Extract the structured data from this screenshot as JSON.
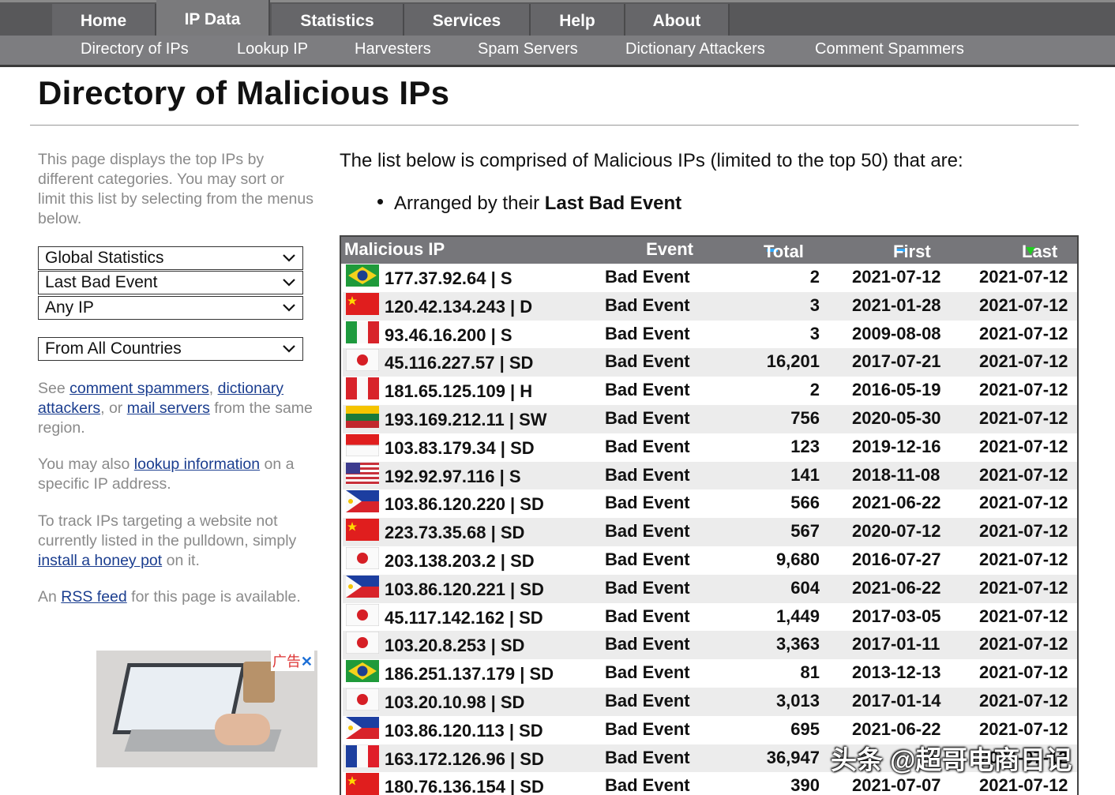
{
  "nav": {
    "tabs": [
      {
        "label": "Home"
      },
      {
        "label": "IP Data"
      },
      {
        "label": "Statistics"
      },
      {
        "label": "Services"
      },
      {
        "label": "Help"
      },
      {
        "label": "About"
      }
    ],
    "subtabs": [
      {
        "label": "Directory of IPs"
      },
      {
        "label": "Lookup IP"
      },
      {
        "label": "Harvesters"
      },
      {
        "label": "Spam Servers"
      },
      {
        "label": "Dictionary Attackers"
      },
      {
        "label": "Comment Spammers"
      }
    ]
  },
  "page": {
    "title": "Directory of Malicious IPs"
  },
  "sidebar": {
    "intro": "This page displays the top IPs by different categories. You may sort or limit this list by selecting from the menus below.",
    "selects": [
      {
        "value": "Global Statistics"
      },
      {
        "value": "Last Bad Event"
      },
      {
        "value": "Any IP"
      },
      {
        "value": "From All Countries"
      }
    ],
    "see": {
      "prefix": "See ",
      "link1": "comment spammers",
      "sep1": ", ",
      "link2": "dictionary attackers",
      "sep2": ", or ",
      "link3": "mail servers",
      "suffix": " from the same region."
    },
    "lookup": {
      "prefix": "You may also ",
      "link": "lookup information",
      "suffix": " on a specific IP address."
    },
    "track": {
      "prefix": "To track IPs targeting a website not currently listed in the pulldown, simply ",
      "link": "install a honey pot",
      "suffix": " on it."
    },
    "rss": {
      "prefix": "An ",
      "link": "RSS feed",
      "suffix": " for this page is available."
    },
    "ad_tag": "广告"
  },
  "main": {
    "intro": "The list below is comprised of Malicious IPs (limited to the top 50) that are:",
    "bullet_prefix": "Arranged by their ",
    "bullet_strong": "Last Bad Event"
  },
  "table": {
    "headers": {
      "ip": "Malicious IP",
      "event": "Event",
      "total": "Total",
      "first": "First",
      "last": "Last"
    },
    "colors": {
      "sort_active": "#22cc22",
      "sort_inactive": "#2ea8ff"
    },
    "rows": [
      {
        "flag": "br",
        "ip": "177.37.92.64 | S",
        "event": "Bad Event",
        "total": "2",
        "first": "2021-07-12",
        "last": "2021-07-12"
      },
      {
        "flag": "cn",
        "ip": "120.42.134.243 | D",
        "event": "Bad Event",
        "total": "3",
        "first": "2021-01-28",
        "last": "2021-07-12"
      },
      {
        "flag": "it",
        "ip": "93.46.16.200 | S",
        "event": "Bad Event",
        "total": "3",
        "first": "2009-08-08",
        "last": "2021-07-12"
      },
      {
        "flag": "jp",
        "ip": "45.116.227.57 | SD",
        "event": "Bad Event",
        "total": "16,201",
        "first": "2017-07-21",
        "last": "2021-07-12"
      },
      {
        "flag": "pe",
        "ip": "181.65.125.109 | H",
        "event": "Bad Event",
        "total": "2",
        "first": "2016-05-19",
        "last": "2021-07-12"
      },
      {
        "flag": "lt",
        "ip": "193.169.212.11 | SW",
        "event": "Bad Event",
        "total": "756",
        "first": "2020-05-30",
        "last": "2021-07-12"
      },
      {
        "flag": "id",
        "ip": "103.83.179.34 | SD",
        "event": "Bad Event",
        "total": "123",
        "first": "2019-12-16",
        "last": "2021-07-12"
      },
      {
        "flag": "us",
        "ip": "192.92.97.116 | S",
        "event": "Bad Event",
        "total": "141",
        "first": "2018-11-08",
        "last": "2021-07-12"
      },
      {
        "flag": "ph",
        "ip": "103.86.120.220 | SD",
        "event": "Bad Event",
        "total": "566",
        "first": "2021-06-22",
        "last": "2021-07-12"
      },
      {
        "flag": "cn",
        "ip": "223.73.35.68 | SD",
        "event": "Bad Event",
        "total": "567",
        "first": "2020-07-12",
        "last": "2021-07-12"
      },
      {
        "flag": "jp",
        "ip": "203.138.203.2 | SD",
        "event": "Bad Event",
        "total": "9,680",
        "first": "2016-07-27",
        "last": "2021-07-12"
      },
      {
        "flag": "ph",
        "ip": "103.86.120.221 | SD",
        "event": "Bad Event",
        "total": "604",
        "first": "2021-06-22",
        "last": "2021-07-12"
      },
      {
        "flag": "jp",
        "ip": "45.117.142.162 | SD",
        "event": "Bad Event",
        "total": "1,449",
        "first": "2017-03-05",
        "last": "2021-07-12"
      },
      {
        "flag": "jp",
        "ip": "103.20.8.253 | SD",
        "event": "Bad Event",
        "total": "3,363",
        "first": "2017-01-11",
        "last": "2021-07-12"
      },
      {
        "flag": "br",
        "ip": "186.251.137.179 | SD",
        "event": "Bad Event",
        "total": "81",
        "first": "2013-12-13",
        "last": "2021-07-12"
      },
      {
        "flag": "jp",
        "ip": "103.20.10.98 | SD",
        "event": "Bad Event",
        "total": "3,013",
        "first": "2017-01-14",
        "last": "2021-07-12"
      },
      {
        "flag": "ph",
        "ip": "103.86.120.113 | SD",
        "event": "Bad Event",
        "total": "695",
        "first": "2021-06-22",
        "last": "2021-07-12"
      },
      {
        "flag": "fr",
        "ip": "163.172.126.96 | SD",
        "event": "Bad Event",
        "total": "36,947",
        "first": "",
        "last": "2021-07-12"
      },
      {
        "flag": "cn",
        "ip": "180.76.136.154 | SD",
        "event": "Bad Event",
        "total": "390",
        "first": "2021-07-07",
        "last": "2021-07-12"
      }
    ]
  },
  "watermark": "头条 @超哥电商日记"
}
